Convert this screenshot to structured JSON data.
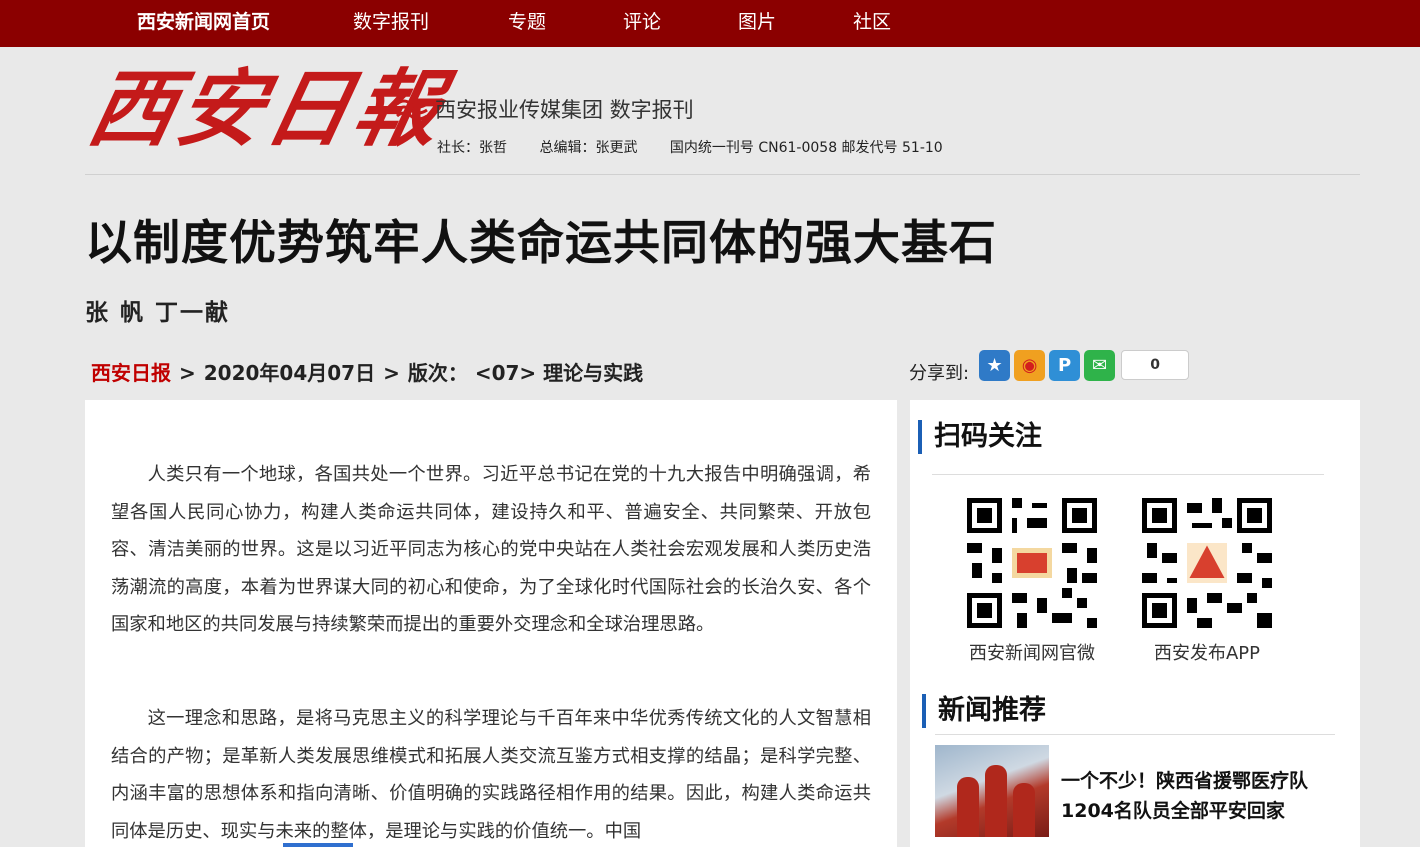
{
  "nav": {
    "items": [
      "西安新闻网首页",
      "数字报刊",
      "专题",
      "评论",
      "图片",
      "社区"
    ]
  },
  "masthead": {
    "logo_text": "西安日報",
    "group_name": "西安报业传媒集团 数字报刊",
    "staff": [
      "社长：张哲",
      "总编辑：张更武",
      "国内统一刊号 CN61-0058  邮发代号 51-10"
    ]
  },
  "article": {
    "title": "以制度优势筑牢人类命运共同体的强大基石",
    "authors": "张 帆 丁一献",
    "breadcrumb": {
      "paper": "西安日报",
      "sep1": ">",
      "date": "2020年04月07日",
      "sep2": ">",
      "edition_label": "版次：",
      "edition": "<07> 理论与实践"
    },
    "paragraphs": [
      "人类只有一个地球，各国共处一个世界。习近平总书记在党的十九大报告中明确强调，希望各国人民同心协力，构建人类命运共同体，建设持久和平、普遍安全、共同繁荣、开放包容、清洁美丽的世界。这是以习近平同志为核心的党中央站在人类社会宏观发展和人类历史浩荡潮流的高度，本着为世界谋大同的初心和使命，为了全球化时代国际社会的长治久安、各个国家和地区的共同发展与持续繁荣而提出的重要外交理念和全球治理思路。",
      "这一理念和思路，是将马克思主义的科学理论与千百年来中华优秀传统文化的人文智慧相结合的产物；是革新人类发展思维模式和拓展人类交流互鉴方式相支撑的结晶；是科学完整、内涵丰富的思想体系和指向清晰、价值明确的实践路径相作用的结果。因此，构建人类命运共同体是历史、现实与未来的整体，是理论与实践的价值统一。中国"
    ]
  },
  "share": {
    "label": "分享到:",
    "count": "0",
    "icons": [
      "qzone-icon",
      "weibo-icon",
      "pengyou-icon",
      "wechat-icon"
    ]
  },
  "sidebar": {
    "qr_title": "扫码关注",
    "qr_labels": [
      "西安新闻网官微",
      "西安发布APP"
    ],
    "news_title": "新闻推荐",
    "news_item": "一个不少！陕西省援鄂医疗队1204名队员全部平安回家"
  },
  "colors": {
    "nav_bg": "#8b0000",
    "logo_red": "#c41a1a",
    "accent_blue": "#1b5fb5",
    "paper_red": "#c00000"
  }
}
